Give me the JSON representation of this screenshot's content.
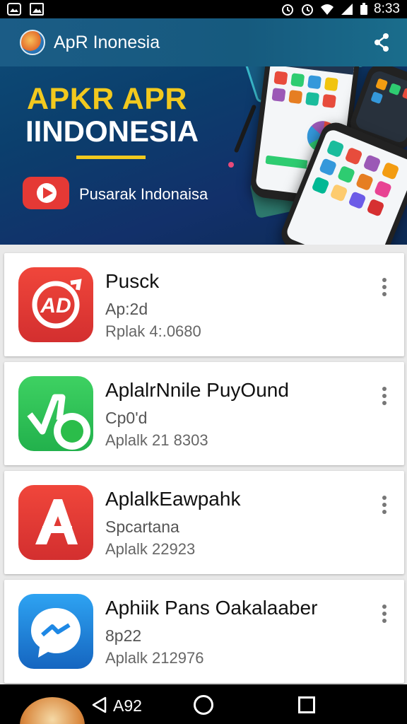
{
  "status_bar": {
    "time": "8:33",
    "icons": [
      "gallery-icon",
      "image-icon",
      "alarm-icon",
      "alarm-icon",
      "wifi-icon",
      "signal-icon",
      "battery-icon"
    ]
  },
  "banner": {
    "brand_name": "ApR Inonesia",
    "headline_line1": "APKR APR",
    "headline_line2": "IINDONESIA",
    "subtext": "Pusarak Indonaisa",
    "accent_color": "#f2c91e",
    "background_color": "#0b3f6d"
  },
  "apps": [
    {
      "title": "Pusck",
      "subtitle": "Ap:2d",
      "meta": "Rplak 4:.0680",
      "icon": "red-ad-icon",
      "icon_color": "#e53935"
    },
    {
      "title": "AplalrNnile PuyOund",
      "subtitle": "Cp0'd",
      "meta": "Aplalk 21 8303",
      "icon": "green-check-icon",
      "icon_color": "#2bbd4a"
    },
    {
      "title": "AplalkEawpahk",
      "subtitle": "Spcartana",
      "meta": "Aplalk 22923",
      "icon": "red-a-icon",
      "icon_color": "#e53935"
    },
    {
      "title": "Aphiik Pans Oakalaaber",
      "subtitle": "8p22",
      "meta": "Aplalk 212976",
      "icon": "blue-messenger-icon",
      "icon_color": "#1e88e5"
    }
  ],
  "navbar": {
    "label": "A92"
  }
}
